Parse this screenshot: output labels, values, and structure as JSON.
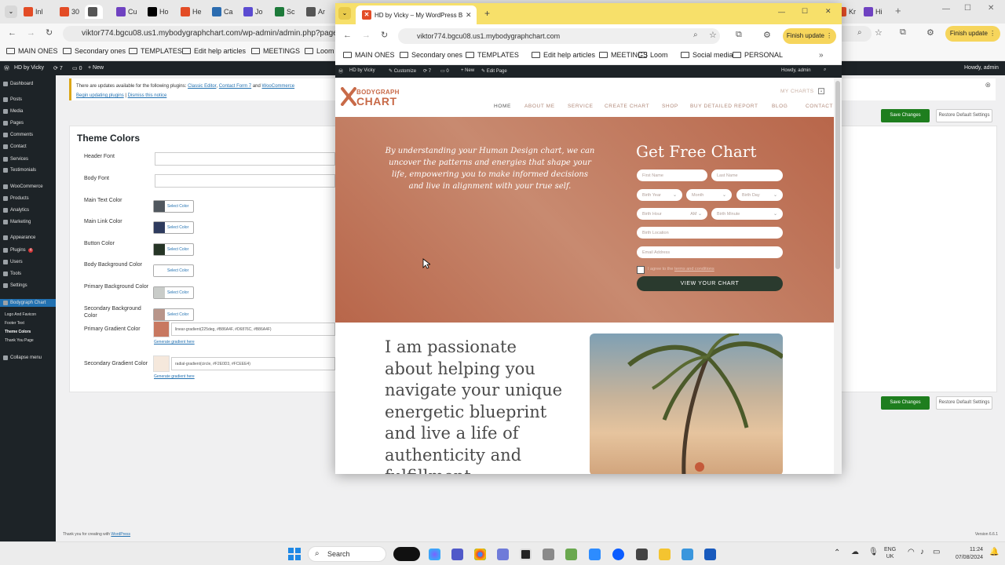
{
  "background_browser": {
    "tabs": [
      {
        "label": "Inl",
        "color": "#e34c26",
        "icon": "x-logo-icon"
      },
      {
        "label": "30",
        "color": "#e34c26",
        "icon": "x-logo-icon"
      },
      {
        "label": "",
        "color": "#555555",
        "icon": "chrome-icon"
      },
      {
        "label": "Cu",
        "color": "#6f42c1",
        "icon": "s-logo-icon"
      },
      {
        "label": "Ho",
        "color": "#000000",
        "icon": "notion-icon"
      },
      {
        "label": "He",
        "color": "#e34c26",
        "icon": "x-logo-icon"
      },
      {
        "label": "Ca",
        "color": "#2b6cb0",
        "icon": "calendar-icon"
      },
      {
        "label": "Jo",
        "color": "#5b4bd1",
        "icon": "teams-icon"
      },
      {
        "label": "Sc",
        "color": "#1d7a3a",
        "icon": "excel-icon"
      },
      {
        "label": "Ar",
        "color": "#555555",
        "icon": "globe-icon"
      },
      {
        "label": "Kr",
        "color": "#e34c26",
        "icon": "x-logo-icon"
      },
      {
        "label": "Hi",
        "color": "#6f42c1",
        "icon": "gear-icon"
      }
    ],
    "address": "viktor774.bgcu08.us1.mybodygraphchart.com/wp-admin/admin.php?page=bo",
    "finish_update": "Finish update",
    "bookmarks": [
      "MAIN ONES",
      "Secondary ones",
      "TEMPLATES",
      "Edit help articles",
      "MEETINGS",
      "Loom"
    ]
  },
  "wp_admin": {
    "adminbar": {
      "site": "HD by Vicky",
      "comments": "7",
      "updates": "0",
      "new": "+ New",
      "howdy": "Howdy, admin"
    },
    "menu": [
      "Dashboard",
      "Posts",
      "Media",
      "Pages",
      "Comments",
      "Contact",
      "Services",
      "Testimonials",
      "WooCommerce",
      "Products",
      "Analytics",
      "Marketing",
      "Appearance",
      "Plugins",
      "Users",
      "Tools",
      "Settings",
      "Bodygraph Chart",
      "Logo And Favicon",
      "Footer Text",
      "Theme Colors",
      "Thank You Page",
      "Collapse menu"
    ],
    "plugin_badge": "4",
    "notice": {
      "text": "There are updates available for the following plugins:",
      "plugins": [
        "Classic Editor",
        "Contact Form 7",
        "WooCommerce"
      ],
      "and": "and",
      "begin": "Begin updating plugins",
      "sep": "|",
      "dismiss": "Dismiss this notice"
    },
    "panel_title": "Theme Colors",
    "fields": [
      {
        "label": "Header Font",
        "type": "text"
      },
      {
        "label": "Body Font",
        "type": "text"
      },
      {
        "label": "Main Text Color",
        "type": "color",
        "color": "#50575e"
      },
      {
        "label": "Main Link Color",
        "type": "color",
        "color": "#2e3b5e"
      },
      {
        "label": "Button Color",
        "type": "color",
        "color": "#263526"
      },
      {
        "label": "Body Background Color",
        "type": "color",
        "color": "#ffffff"
      },
      {
        "label": "Primary Background Color",
        "type": "color",
        "color": "#c9ccc9"
      },
      {
        "label": "Secondary Background Color",
        "type": "color",
        "color": "#b8958a"
      },
      {
        "label": "Primary Gradient Color",
        "type": "gradient",
        "color": "#c87860",
        "value": "linear-gradient(225deg, #B86A4F, #D6876C, #B86A4F)",
        "link": "Generate gradient here"
      },
      {
        "label": "Secondary Gradient Color",
        "type": "gradient",
        "color": "#f5e8dc",
        "value": "radial-gradient(circle, #F2E0D3, #FCEEE4)",
        "link": "Generate gradient here"
      }
    ],
    "select_color": "Select Color",
    "save": "Save Changes",
    "reset": "Restore Default Settings",
    "footer_text": "Thank you for creating with",
    "footer_link": "WordPress",
    "version": "Version 6.6.1"
  },
  "popup": {
    "tab_title": "HD by Vicky – My WordPress Bl",
    "address": "viktor774.bgcu08.us1.mybodygraphchart.com",
    "finish_update": "Finish update",
    "bookmarks": [
      "MAIN ONES",
      "Secondary ones",
      "TEMPLATES",
      "Edit help articles",
      "MEETINGS",
      "Loom",
      "Social media",
      "PERSONAL"
    ],
    "adminbar": {
      "site": "HD by Vicky",
      "customize": "Customize",
      "comments": "7",
      "updates": "0",
      "new": "+ New",
      "edit": "Edit Page",
      "howdy": "Howdy, admin"
    },
    "site": {
      "logo_top": "BODYGRAPH",
      "logo_bottom": "CHART",
      "my_charts": "MY CHARTS",
      "nav": [
        "HOME",
        "ABOUT ME",
        "SERVICE",
        "CREATE CHART",
        "SHOP",
        "BUY DETAILED REPORT",
        "BLOG",
        "CONTACT"
      ],
      "hero_text": "By understanding your Human Design chart, we can uncover the patterns and energies that shape your life, empowering you to make informed decisions and live in alignment with your true self.",
      "form_title": "Get Free Chart",
      "first_name": "First Name",
      "last_name": "Last Name",
      "birth_year": "Birth Year",
      "month": "Month",
      "birth_day": "Birth Day",
      "birth_hour": "Birth Hour",
      "ampm": "AM",
      "birth_minute": "Birth Minute",
      "birth_location": "Birth Location",
      "email": "Email Address",
      "terms_prefix": "I agree to the",
      "terms_link": "terms and conditions",
      "submit": "VIEW YOUR CHART",
      "passion": "I am passionate about helping you navigate your unique energetic blueprint and live a life of authenticity and fulfillment"
    }
  },
  "taskbar": {
    "search": "Search",
    "lang_top": "ENG",
    "lang_bottom": "UK",
    "time": "11:24",
    "date": "07/08/2024"
  }
}
